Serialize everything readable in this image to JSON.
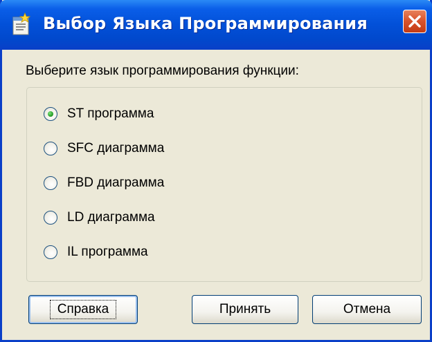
{
  "window": {
    "title": "Выбор Языка Программирования",
    "title_icon": "dialog-window-icon",
    "close_icon": "close-x-icon",
    "accent_color": "#0250d8",
    "close_color": "#d9552e"
  },
  "dialog": {
    "prompt": "Выберите язык программирования функции:",
    "options": [
      {
        "label": "ST программа",
        "selected": true
      },
      {
        "label": "SFC диаграмма",
        "selected": false
      },
      {
        "label": "FBD диаграмма",
        "selected": false
      },
      {
        "label": "LD диаграмма",
        "selected": false
      },
      {
        "label": "IL программа",
        "selected": false
      }
    ]
  },
  "buttons": {
    "help": "Справка",
    "accept": "Принять",
    "cancel": "Отмена"
  }
}
